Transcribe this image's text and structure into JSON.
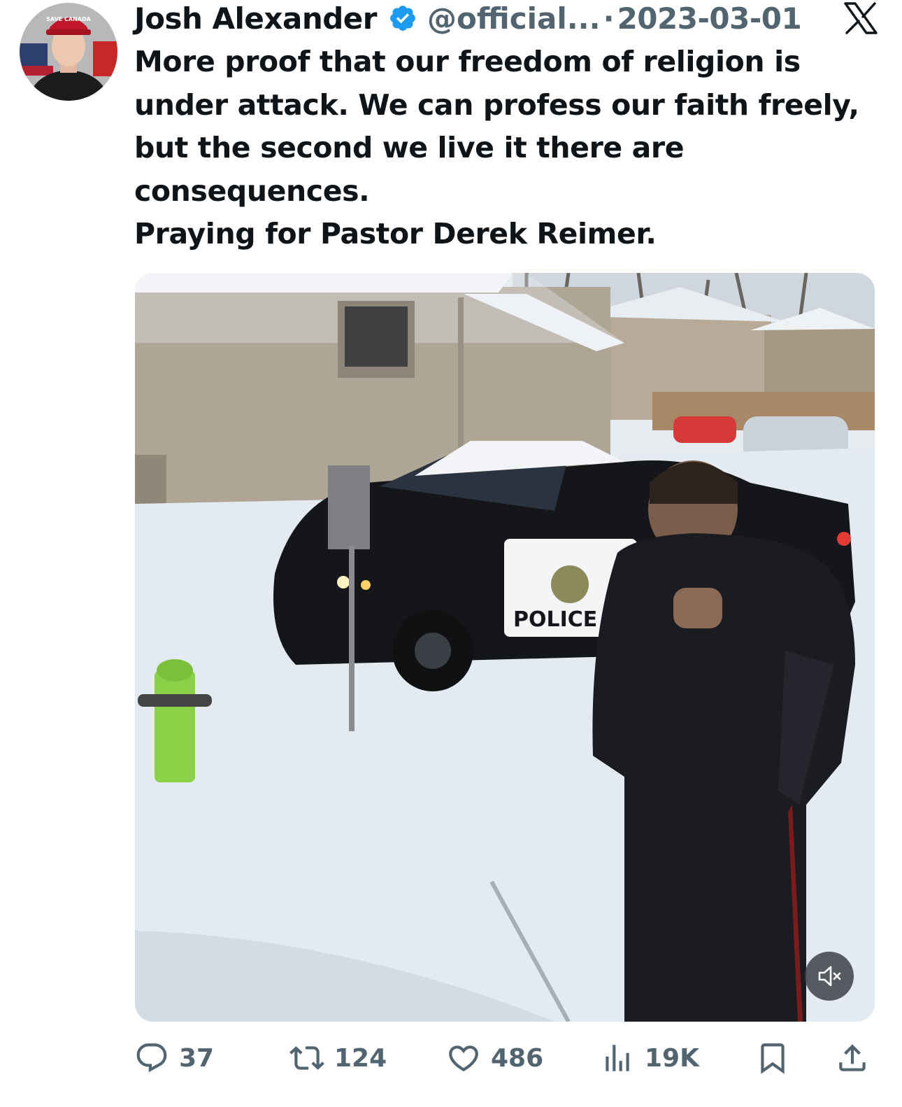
{
  "author": {
    "name": "Josh Alexander",
    "handle": "@official...",
    "separator": "·",
    "date": "2023-03-01",
    "avatar_hat_text": "SAVE CANADA"
  },
  "tweet": {
    "paragraphs": [
      "More proof that our freedom of religion is under attack. We can profess our faith freely, but the second we live it there are consequences.",
      "Praying for Pastor Derek Reimer."
    ]
  },
  "media": {
    "vehicle_text": "POLICE",
    "muted": true
  },
  "actions": {
    "replies": "37",
    "reposts": "124",
    "likes": "486",
    "views": "19K"
  },
  "colors": {
    "text": "#0f1419",
    "secondary": "#536471",
    "verified": "#1d9bf0"
  },
  "icons": [
    "verified-badge-icon",
    "x-logo-icon",
    "mute-icon",
    "reply-icon",
    "repost-icon",
    "like-icon",
    "views-icon",
    "bookmark-icon",
    "share-icon"
  ]
}
